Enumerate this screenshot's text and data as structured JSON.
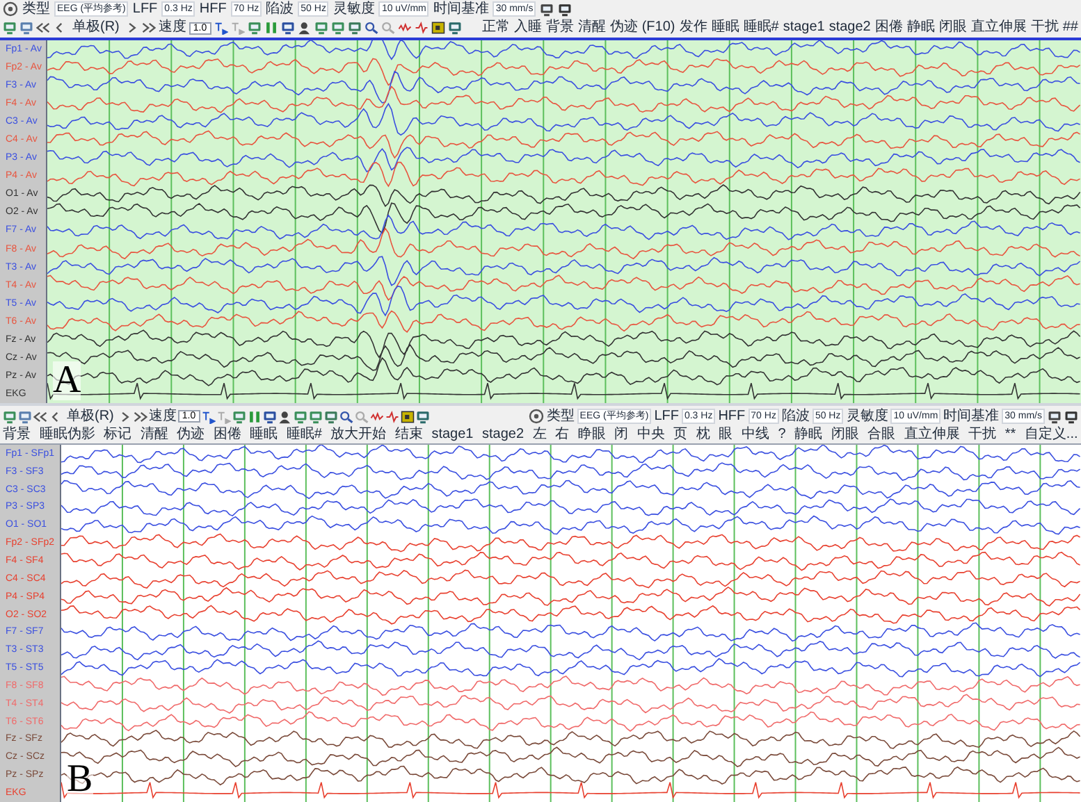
{
  "panel_a": {
    "label": "A",
    "settings": [
      {
        "label": "类型",
        "value": "EEG (平均参考)"
      },
      {
        "label": "LFF",
        "value": "0.3 Hz"
      },
      {
        "label": "HFF",
        "value": "70 Hz"
      },
      {
        "label": "陷波",
        "value": "50 Hz"
      },
      {
        "label": "灵敏度",
        "value": "10 uV/mm"
      },
      {
        "label": "时间基准",
        "value": "30 mm/s"
      }
    ],
    "montage": "单极(R)",
    "speed_label": "速度",
    "speed": "1.0",
    "events": [
      "正常",
      "入睡",
      "背景",
      "清醒",
      "伪迹 (F10)",
      "发作",
      "睡眠",
      "睡眠#",
      "stage1",
      "stage2",
      "困倦",
      "静眠",
      "闭眼",
      "直立伸展",
      "干扰",
      "##"
    ],
    "channels": [
      {
        "name": "Fp1 - Av",
        "color": "#3a4fe0",
        "kind": "eeg"
      },
      {
        "name": "Fp2 - Av",
        "color": "#e8553f",
        "kind": "eeg"
      },
      {
        "name": "F3 - Av",
        "color": "#3a4fe0",
        "kind": "eeg"
      },
      {
        "name": "F4 - Av",
        "color": "#e8553f",
        "kind": "eeg"
      },
      {
        "name": "C3 - Av",
        "color": "#3a4fe0",
        "kind": "eeg"
      },
      {
        "name": "C4 - Av",
        "color": "#e8553f",
        "kind": "eeg"
      },
      {
        "name": "P3 - Av",
        "color": "#3a4fe0",
        "kind": "eeg"
      },
      {
        "name": "P4 - Av",
        "color": "#e8553f",
        "kind": "eeg"
      },
      {
        "name": "O1 - Av",
        "color": "#333333",
        "kind": "eeg"
      },
      {
        "name": "O2 - Av",
        "color": "#333333",
        "kind": "eeg"
      },
      {
        "name": "F7 - Av",
        "color": "#3a4fe0",
        "kind": "eeg"
      },
      {
        "name": "F8 - Av",
        "color": "#e8553f",
        "kind": "eeg"
      },
      {
        "name": "T3 - Av",
        "color": "#3a4fe0",
        "kind": "eeg"
      },
      {
        "name": "T4 - Av",
        "color": "#e8553f",
        "kind": "eeg"
      },
      {
        "name": "T5 - Av",
        "color": "#3a4fe0",
        "kind": "eeg"
      },
      {
        "name": "T6 - Av",
        "color": "#e8553f",
        "kind": "eeg"
      },
      {
        "name": "Fz - Av",
        "color": "#333333",
        "kind": "eeg"
      },
      {
        "name": "Cz - Av",
        "color": "#333333",
        "kind": "eeg"
      },
      {
        "name": "Pz - Av",
        "color": "#333333",
        "kind": "eeg"
      },
      {
        "name": "EKG",
        "color": "#333333",
        "kind": "ekg"
      }
    ]
  },
  "panel_b": {
    "label": "B",
    "settings": [
      {
        "label": "类型",
        "value": "EEG (平均参考)"
      },
      {
        "label": "LFF",
        "value": "0.3 Hz"
      },
      {
        "label": "HFF",
        "value": "70 Hz"
      },
      {
        "label": "陷波",
        "value": "50 Hz"
      },
      {
        "label": "灵敏度",
        "value": "10 uV/mm"
      },
      {
        "label": "时间基准",
        "value": "30 mm/s"
      }
    ],
    "montage": "单极(R)",
    "speed_label": "速度",
    "speed": "1.0",
    "events": [
      "背景",
      "睡眠伪影",
      "标记",
      "清醒",
      "伪迹",
      "困倦",
      "睡眠",
      "睡眠#",
      "放大开始",
      "结束",
      "stage1",
      "stage2",
      "左",
      "右",
      "睁眼",
      "闭",
      "中央",
      "页",
      "枕",
      "眼",
      "中线",
      "?",
      "静眠",
      "闭眼",
      "合眼",
      "直立伸展",
      "干扰",
      "**",
      "自定义..."
    ],
    "channels": [
      {
        "name": "Fp1 - SFp1",
        "color": "#3a4fe0",
        "kind": "eeg"
      },
      {
        "name": "F3 - SF3",
        "color": "#3a4fe0",
        "kind": "eeg"
      },
      {
        "name": "C3 - SC3",
        "color": "#3a4fe0",
        "kind": "eeg"
      },
      {
        "name": "P3 - SP3",
        "color": "#3a4fe0",
        "kind": "eeg"
      },
      {
        "name": "O1 - SO1",
        "color": "#3a4fe0",
        "kind": "eeg"
      },
      {
        "name": "Fp2 - SFp2",
        "color": "#e8402f",
        "kind": "eeg"
      },
      {
        "name": "F4 - SF4",
        "color": "#e8402f",
        "kind": "eeg"
      },
      {
        "name": "C4 - SC4",
        "color": "#e8402f",
        "kind": "eeg"
      },
      {
        "name": "P4 - SP4",
        "color": "#e8402f",
        "kind": "eeg"
      },
      {
        "name": "O2 - SO2",
        "color": "#e8402f",
        "kind": "eeg"
      },
      {
        "name": "F7 - SF7",
        "color": "#3a4fe0",
        "kind": "eeg"
      },
      {
        "name": "T3 - ST3",
        "color": "#3a4fe0",
        "kind": "eeg"
      },
      {
        "name": "T5 - ST5",
        "color": "#3a4fe0",
        "kind": "eeg"
      },
      {
        "name": "F8 - SF8",
        "color": "#f06a6a",
        "kind": "eeg"
      },
      {
        "name": "T4 - ST4",
        "color": "#f06a6a",
        "kind": "eeg"
      },
      {
        "name": "T6 - ST6",
        "color": "#f06a6a",
        "kind": "eeg"
      },
      {
        "name": "Fz - SFz",
        "color": "#7a4a3a",
        "kind": "eeg"
      },
      {
        "name": "Cz - SCz",
        "color": "#7a4a3a",
        "kind": "eeg"
      },
      {
        "name": "Pz - SPz",
        "color": "#7a4a3a",
        "kind": "eeg"
      },
      {
        "name": "EKG",
        "color": "#e8402f",
        "kind": "ekg"
      }
    ]
  }
}
